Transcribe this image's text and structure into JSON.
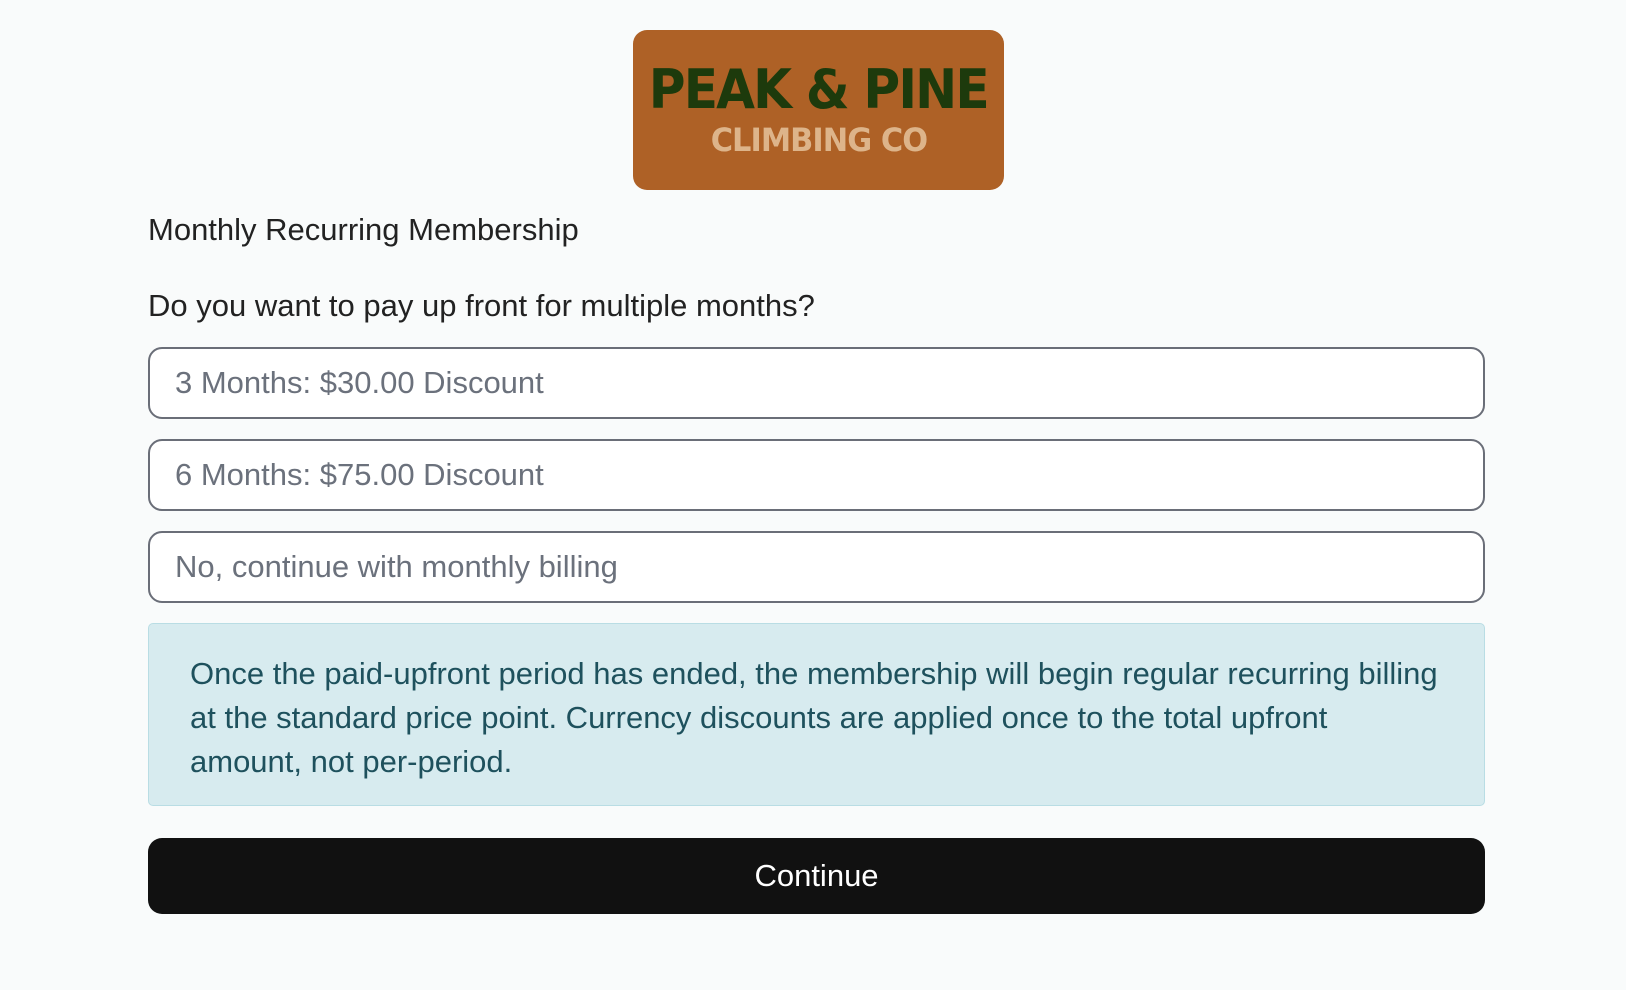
{
  "logo": {
    "main_text": "PEAK & PINE",
    "sub_text": "CLIMBING CO",
    "background_color": "#ae6126",
    "main_color": "#1d3a0c",
    "sub_color": "#ddb48a"
  },
  "membership": {
    "name": "Monthly Recurring Membership"
  },
  "question": "Do you want to pay up front for multiple months?",
  "options": [
    {
      "label": "3 Months: $30.00 Discount"
    },
    {
      "label": "6 Months: $75.00 Discount"
    },
    {
      "label": "No, continue with monthly billing"
    }
  ],
  "notice": {
    "text": "Once the paid-upfront period has ended, the membership will begin regular recurring billing at the standard price point. Currency discounts are applied once to the total upfront amount, not per-period."
  },
  "continue_button": {
    "label": "Continue"
  },
  "colors": {
    "page_background": "#f9fbfb",
    "notice_background": "#d7ebef",
    "notice_text": "#1e515d",
    "button_background": "#111111",
    "button_text": "#ffffff"
  }
}
